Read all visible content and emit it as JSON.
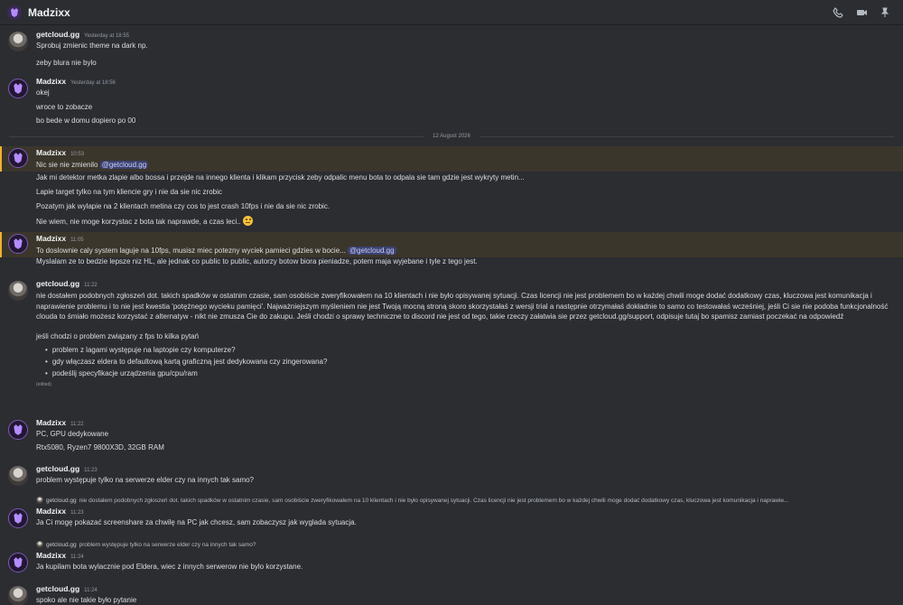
{
  "header": {
    "title": "Madzixx"
  },
  "date_divider": "12 August 2026",
  "messages": [
    {
      "author": "getcloud.gg",
      "time": "Yesterday at 18:55",
      "lines": [
        "Sprobuj zmienic theme na dark np.",
        "zeby blura nie bylo"
      ]
    },
    {
      "author": "Madzixx",
      "time": "Yesterday at 18:56",
      "lines": [
        "okej",
        "wroce to zobacze",
        "bo bede w domu dopiero po 00"
      ]
    },
    {
      "author": "Madzixx",
      "time": "10:53",
      "line1": "Nic sie nie zmienilo",
      "mention": "@getcloud.gg",
      "lines": [
        "Jak mi detektor metka zlapie albo bossa i przejde na innego klienta i klikam przycisk zeby odpalic menu bota to odpala sie tam gdzie jest wykryty metin...",
        "Lapie target tylko na tym kliencie gry i nie da sie nic zrobic",
        "Pozatym jak wylapie na 2 klientach metina czy cos to jest crash 10fps i nie da sie nic zrobic.",
        "Nie wiem, nie moge korzystac z bota tak naprawde, a czas leci.."
      ]
    },
    {
      "author": "Madzixx",
      "time": "11:05",
      "line1": "To doslownie caly system laguje na 10fps, musisz miec potezny wyciek pamieci gdzies w bocie...",
      "mention": "@getcloud.gg",
      "line2": "Myslalam ze to bedzie lepsze niz HL, ale jednak co public to public, autorzy botow biora pieniadze, potem maja wyjebane i tyle z tego jest."
    },
    {
      "author": "getcloud.gg",
      "time": "11:22",
      "paragraph": "nie dostałem podobnych zgłoszeń dot. takich spadków w ostatnim czasie, sam osobiście zweryfikowałem na 10 klientach i nie było opisywanej sytuacji. Czas licencji nie jest problemem bo w każdej chwili moge dodać dodatkowy czas, kluczowa jest komunikacja i naprawienie problemu i to nie jest kwestia 'potężnego wycieku pamięci'. Najważniejszym myśleniem nie jest Twoją mocną stroną skoro skorzystałaś z wersji trial a następnie otrzymałaś dokładnie to samo co testowałaś wcześniej, jeśli Ci sie nie podoba funkcjonalność clouda to śmiało możesz korzystać z alternatyw - nikt nie zmusza Cie do zakupu. Jeśli chodzi o sprawy techniczne to discord nie jest od tego, takie rzeczy załatwia sie przez getcloud.gg/support, odpisuje tutaj bo spamisz zamiast poczekać na odpowiedź",
      "intro": "jeśli chodzi o problem związany z fps to kilka pytań",
      "bullets": [
        "problem z lagami występuje na laptopie czy komputerze?",
        "gdy włączasz eldera to defaultową kartą graficzną jest dedykowana czy zingerowana?",
        "podeślij specyfikacje urządzenia gpu/cpu/ram"
      ],
      "edited": "(edited)"
    },
    {
      "author": "Madzixx",
      "time": "11:22",
      "lines": [
        "PC, GPU dedykowane",
        "Rtx5080, Ryzen7 9800X3D, 32GB RAM"
      ]
    },
    {
      "author": "getcloud.gg",
      "time": "11:23",
      "lines": [
        "problem występuje tylko na serwerze elder czy na innych tak samo?"
      ]
    },
    {
      "author": "Madzixx",
      "time": "11:23",
      "reply_to": {
        "author": "getcloud.gg",
        "text": "nie dostałem podobnych zgłoszeń dot. takich spadków w ostatnim czasie, sam osobiście zweryfikowałem na 10 klientach i nie było opisywanej sytuacji. Czas licencji nie jest problemem bo w każdej chwili moge dodać dodatkowy czas, kluczowa jest komunikacja i naprawie..."
      },
      "lines": [
        "Ja Ci mogę pokazać screenshare za chwilę na PC jak chcesz, sam zobaczysz jak wyglada sytuacja."
      ]
    },
    {
      "author": "Madzixx",
      "time": "11:24",
      "reply_to": {
        "author": "getcloud.gg",
        "text": "problem występuje tylko na serwerze elder czy na innych tak samo?"
      },
      "lines": [
        "Ja kupilam bota wylacznie pod Eldera, wiec z innych serwerow nie bylo korzystane."
      ]
    },
    {
      "author": "getcloud.gg",
      "time": "11:24",
      "lines": [
        "spoko ale nie takie było pytanie"
      ]
    }
  ]
}
